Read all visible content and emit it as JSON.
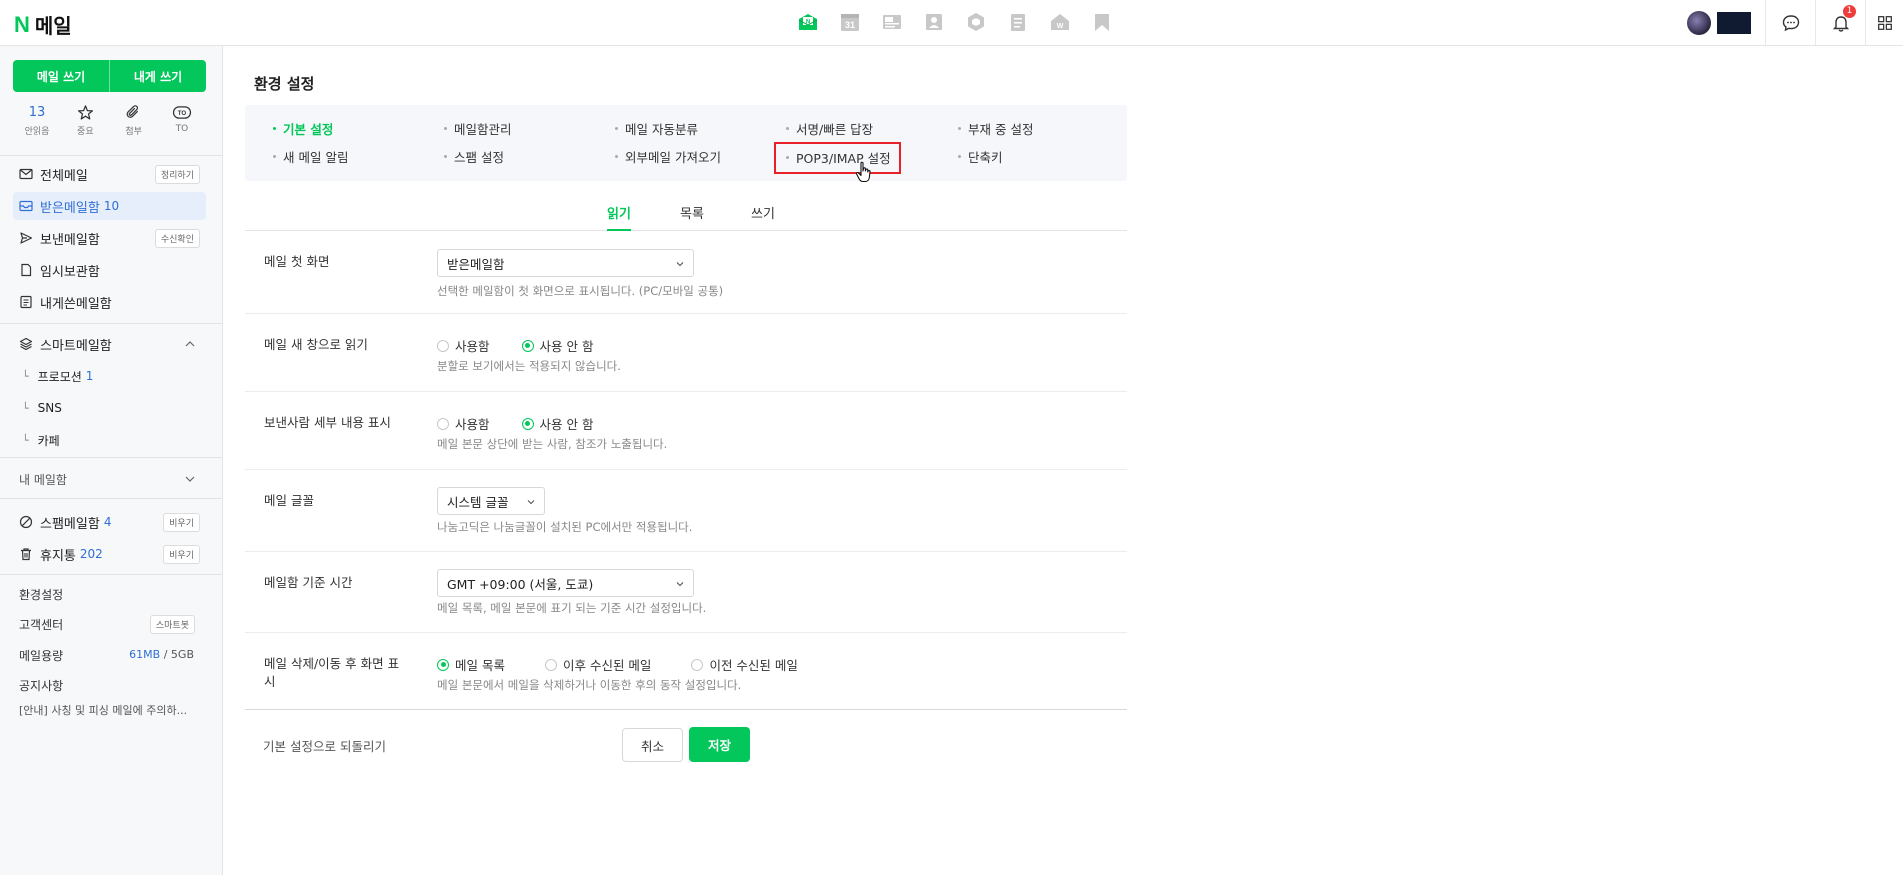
{
  "header": {
    "logo_letter": "N",
    "logo_text": "메일",
    "apps": [
      "mail-app-icon",
      "calendar-31-icon",
      "photo-icon",
      "contacts-icon",
      "cloud-box-icon",
      "memo-icon",
      "office-icon",
      "bookmark-icon"
    ],
    "calendar_day": "31",
    "notification_count": "1"
  },
  "sidebar": {
    "compose": "메일 쓰기",
    "compose_self": "내게 쓰기",
    "quick": [
      {
        "value": "13",
        "label": "안읽음"
      },
      {
        "icon": "star-icon",
        "label": "중요"
      },
      {
        "icon": "paperclip-icon",
        "label": "첨부"
      },
      {
        "icon": "to-icon",
        "label": "TO",
        "badge": "TO"
      }
    ],
    "all_mail": "전체메일",
    "all_mail_btn": "정리하기",
    "inbox": "받은메일함",
    "inbox_count": "10",
    "sent": "보낸메일함",
    "sent_btn": "수신확인",
    "drafts": "임시보관함",
    "self_mail": "내게쓴메일함",
    "smart": "스마트메일함",
    "smart_subs": [
      {
        "label": "프로모션",
        "count": "1"
      },
      {
        "label": "SNS",
        "count": ""
      },
      {
        "label": "카페",
        "count": ""
      }
    ],
    "my_folders": "내 메일함",
    "spam": "스팸메일함",
    "spam_count": "4",
    "spam_btn": "비우기",
    "trash": "휴지통",
    "trash_count": "202",
    "trash_btn": "비우기",
    "settings": "환경설정",
    "support": "고객센터",
    "support_btn": "스마트봇",
    "storage_label": "메일용량",
    "storage_used": "61MB",
    "storage_sep": "/",
    "storage_total": "5GB",
    "notice_title": "공지사항",
    "notice_text": "[안내] 사칭 및 피싱 메일에 주의하..."
  },
  "main": {
    "title": "환경 설정",
    "menu": [
      "기본 설정",
      "메일함관리",
      "메일 자동분류",
      "서명/빠른 답장",
      "부재 중 설정",
      "새 메일 알림",
      "스팸 설정",
      "외부메일 가져오기",
      "POP3/IMAP 설정",
      "단축키"
    ],
    "tabs": [
      "읽기",
      "목록",
      "쓰기"
    ],
    "rows": {
      "start_screen": {
        "label": "메일 첫 화면",
        "value": "받은메일함",
        "help": "선택한 메일함이 첫 화면으로 표시됩니다. (PC/모바일 공통)"
      },
      "new_window": {
        "label": "메일 새 창으로 읽기",
        "opt_on": "사용함",
        "opt_off": "사용 안 함",
        "selected": "사용 안 함",
        "help": "분할로 보기에서는 적용되지 않습니다."
      },
      "sender_detail": {
        "label": "보낸사람 세부 내용 표시",
        "opt_on": "사용함",
        "opt_off": "사용 안 함",
        "selected": "사용 안 함",
        "help": "메일 본문 상단에 받는 사람, 참조가 노출됩니다."
      },
      "font": {
        "label": "메일 글꼴",
        "value": "시스템 글꼴",
        "help": "나눔고딕은 나눔글꼴이 설치된 PC에서만 적용됩니다."
      },
      "timezone": {
        "label": "메일함 기준 시간",
        "value": "GMT +09:00 (서울, 도쿄)",
        "help": "메일 목록, 메일 본문에 표기 되는 기준 시간 설정입니다."
      },
      "after_delete": {
        "label_line1": "메일 삭제/이동 후 화면 표",
        "label_line2": "시",
        "opt1": "메일 목록",
        "opt2": "이후 수신된 메일",
        "opt3": "이전 수신된 메일",
        "selected": "메일 목록",
        "help": "메일 본문에서 메일을 삭제하거나 이동한 후의 동작 설정입니다."
      }
    },
    "reset": "기본 설정으로 되돌리기",
    "cancel": "취소",
    "save": "저장"
  },
  "colors": {
    "accent": "#03c75a",
    "link_blue": "#2f6fd6",
    "highlight_box": "#e8202a"
  }
}
